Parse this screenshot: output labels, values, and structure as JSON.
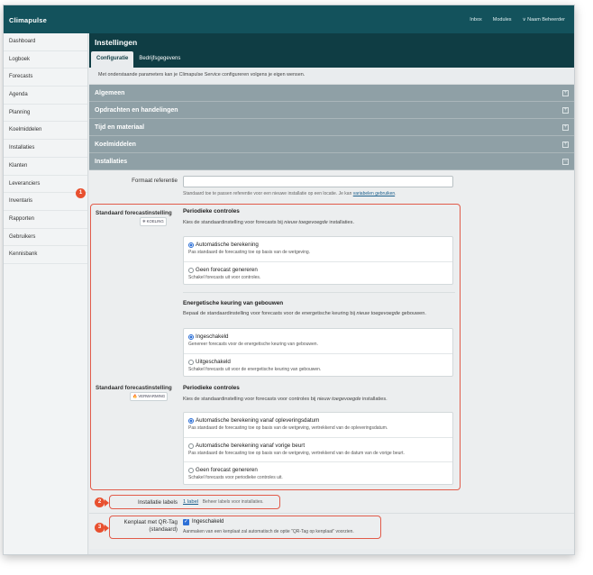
{
  "app": {
    "logo": "Climapulse"
  },
  "topnav": {
    "inbox": "Inbox",
    "modules": "Modules",
    "user": "∨ Naam Beheerder"
  },
  "sidebar": {
    "items": [
      "Dashboard",
      "Logboek",
      "Forecasts",
      "Agenda",
      "Planning",
      "Koelmiddelen",
      "Installaties",
      "Klanten",
      "Leveranciers",
      "Inventaris",
      "Rapporten",
      "Gebruikers",
      "Kennisbank"
    ]
  },
  "main": {
    "title": "Instellingen",
    "tabs": [
      "Configuratie",
      "Bedrijfsgegevens"
    ],
    "intro": "Met onderstaande parameters kan je Climapulse Service configureren volgens je eigen wensen."
  },
  "sections": [
    "Algemeen",
    "Opdrachten en handelingen",
    "Tijd en materiaal",
    "Koelmiddelen",
    "Installaties"
  ],
  "installaties": {
    "ref_label": "Formaat referentie",
    "ref_help": "Standaard toe te passen referentie voor een nieuwe installatie op een locatie. Je kan",
    "ref_help_link": "variabelen gebruiken",
    "ref_help_end": ".",
    "block1": {
      "label": "Standaard forecastinstelling",
      "tag": "KOELING",
      "title": "Periodieke controles",
      "desc_pre": "Kies de standaardinstelling voor forecasts bij ",
      "desc_em": "nieuw toegevoegde",
      "desc_post": " installaties.",
      "options": [
        {
          "title": "Automatische berekening",
          "sub": "Pas standaard de forecasting toe op basis van de wetgeving."
        },
        {
          "title": "Geen forecast genereren",
          "sub": "Schakel forecasts uit voor controles."
        }
      ],
      "title2": "Energetische keuring van gebouwen",
      "desc2_pre": "Bepaal de standaardinstelling voor forecasts voor de energetische keuring bij ",
      "desc2_em": "nieuw toegevoegde",
      "desc2_post": " gebouwen.",
      "options2": [
        {
          "title": "Ingeschakeld",
          "sub": "Genereer forecasts voor de energetische keuring van gebouwen."
        },
        {
          "title": "Uitgeschakeld",
          "sub": "Schakel forecasts uit voor de energetische keuring van gebouwen."
        }
      ]
    },
    "block2": {
      "label": "Standaard forecastinstelling",
      "tag": "VERWARMING",
      "title": "Periodieke controles",
      "desc_pre": "Kies de standaardinstelling voor forecasts voor controles bij ",
      "desc_em": "nieuw toegevoegde",
      "desc_post": " installaties.",
      "options": [
        {
          "title": "Automatische berekening vanaf opleveringsdatum",
          "sub": "Pas standaard de forecasting toe op basis van de wetgeving, vertrekkend van de opleveringsdatum."
        },
        {
          "title": "Automatische berekening vanaf vorige beurt",
          "sub": "Pas standaard de forecasting toe op basis van de wetgeving, vertrekkend van de datum van de vorige beurt."
        },
        {
          "title": "Geen forecast genereren",
          "sub": "Schakel forecasts voor periodieke controles uit."
        }
      ]
    },
    "labels": {
      "label": "Installatie labels",
      "link": "1 label",
      "hint": "Beheer labels voor installaties."
    },
    "qr": {
      "label1": "Kenplaat met QR-Tag",
      "label2": "(standaard)",
      "check": "Ingeschakeld",
      "desc": "Aanmaken van een kenplaat zal automatisch de optie \"QR-Tag op kenplaat\" voorzien."
    }
  },
  "badges": [
    "1",
    "2",
    "3"
  ],
  "colors": {
    "topbar": "#13525c",
    "header": "#0f3d44",
    "section": "#8fa0a6",
    "highlight": "#e15b4a",
    "accent": "#2c6fd6"
  }
}
